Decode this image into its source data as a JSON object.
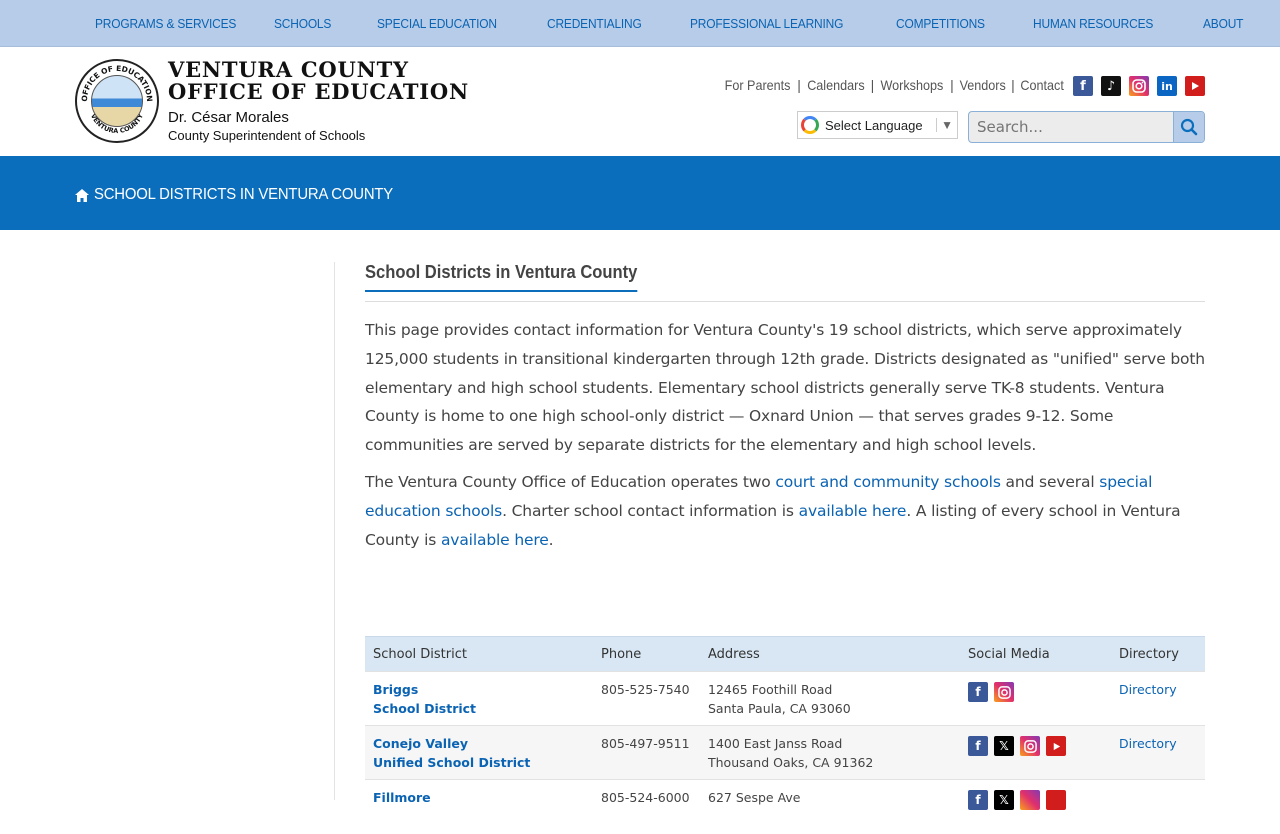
{
  "top_nav": [
    "PROGRAMS & SERVICES",
    "SCHOOLS",
    "SPECIAL EDUCATION",
    "CREDENTIALING",
    "PROFESSIONAL LEARNING",
    "COMPETITIONS",
    "HUMAN RESOURCES",
    "ABOUT"
  ],
  "header": {
    "org_line1": "VENTURA COUNTY",
    "org_line2": "OFFICE OF EDUCATION",
    "superintendent_name": "Dr. César Morales",
    "superintendent_title": "County Superintendent of Schools",
    "seal_top_text": "OFFICE OF EDUCATION",
    "seal_bottom_text": "VENTURA COUNTY",
    "util_links": [
      "For Parents",
      "Calendars",
      "Workshops",
      "Vendors",
      "Contact"
    ],
    "social_icons": [
      "facebook-icon",
      "tiktok-icon",
      "instagram-icon",
      "linkedin-icon",
      "youtube-icon"
    ],
    "translate_label": "Select Language",
    "search_placeholder": "Search..."
  },
  "banner": {
    "breadcrumb": "SCHOOL DISTRICTS IN VENTURA COUNTY"
  },
  "main": {
    "heading": "School Districts in Ventura County",
    "p1": "This page provides contact information for Ventura County's 19 school districts, which serve approximately 125,000 students in transitional kindergarten through 12th grade. Districts designated as \"unified\" serve both elementary and high school students. Elementary school districts generally serve TK-8 students. Ventura County is home to one high school-only district — Oxnard Union — that serves grades 9-12. Some communities are served by separate districts for the elementary and high school levels.",
    "p2_a": "The Ventura County Office of Education operates two ",
    "p2_link1": "court and community schools",
    "p2_b": " and several ",
    "p2_link2": "special education schools",
    "p2_c": ". Charter school contact information is ",
    "p2_link3": "available here",
    "p2_d": ". A listing of every school in Ventura County is ",
    "p2_link4": "available here",
    "p2_e": "."
  },
  "table": {
    "headers": [
      "School District",
      "Phone",
      "Address",
      "Social Media",
      "Directory"
    ],
    "rows": [
      {
        "name1": "Briggs",
        "name2": "School District",
        "phone": "805-525-7540",
        "addr1": "12465 Foothill Road",
        "addr2": "Santa Paula, CA 93060",
        "directory": "Directory"
      },
      {
        "name1": "Conejo Valley",
        "name2": "Unified School District",
        "phone": "805-497-9511",
        "addr1": "1400 East Janss Road",
        "addr2": "Thousand Oaks, CA 91362",
        "directory": "Directory"
      },
      {
        "name1": "Fillmore",
        "name2": "",
        "phone": "805-524-6000",
        "addr1": "627 Sespe Ave",
        "addr2": "",
        "directory": ""
      }
    ]
  },
  "colors": {
    "nav_bg": "#b6cce8",
    "banner_bg": "#0a6ebd",
    "link": "#0a63b3"
  }
}
